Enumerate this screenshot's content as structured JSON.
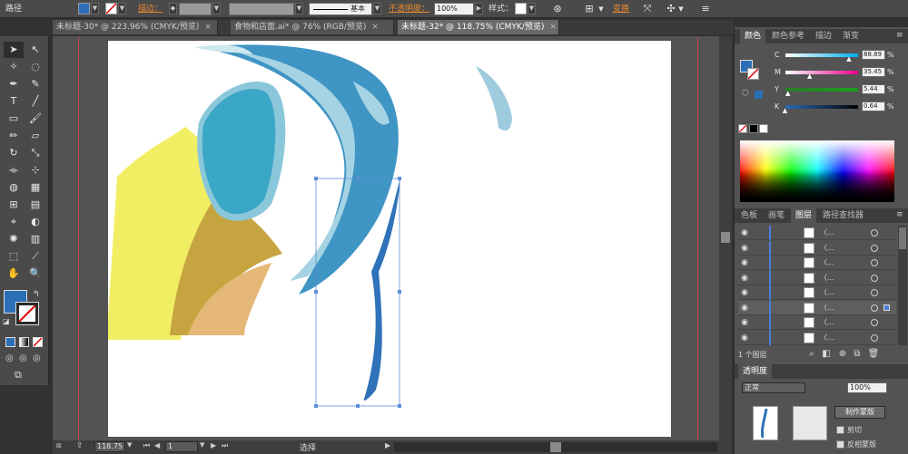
{
  "control_bar": {
    "object_type": "路径",
    "stroke_label": "描边：",
    "stroke_style": "基本",
    "opacity_label": "不透明度：",
    "opacity_value": "100%",
    "style_label": "样式：",
    "transform_label": "变换"
  },
  "tabs": [
    {
      "label": "未标题-30* @ 223.96% (CMYK/预览)",
      "close": "×"
    },
    {
      "label": "食物和店面.ai* @ 76% (RGB/预览)",
      "close": "×"
    },
    {
      "label": "未标题-32* @ 118.75% (CMYK/预览)",
      "close": "×"
    }
  ],
  "tools": {
    "icons": [
      [
        "selection-tool-icon",
        "➤"
      ],
      [
        "direct-selection-tool-icon",
        "↖"
      ],
      [
        "magic-wand-icon",
        "✧"
      ],
      [
        "lasso-icon",
        "◌"
      ],
      [
        "pen-tool-icon",
        "✒"
      ],
      [
        "curvature-icon",
        "✎"
      ],
      [
        "type-tool-icon",
        "T"
      ],
      [
        "line-tool-icon",
        "╱"
      ],
      [
        "rectangle-tool-icon",
        "▭"
      ],
      [
        "paintbrush-icon",
        "🖌"
      ],
      [
        "pencil-icon",
        "✏"
      ],
      [
        "eraser-icon",
        "▱"
      ],
      [
        "rotate-icon",
        "↻"
      ],
      [
        "scale-icon",
        "⤡"
      ],
      [
        "width-tool-icon",
        "⟛"
      ],
      [
        "free-transform-icon",
        "⊹"
      ],
      [
        "shape-builder-icon",
        "◍"
      ],
      [
        "perspective-grid-icon",
        "▦"
      ],
      [
        "mesh-icon",
        "⊞"
      ],
      [
        "gradient-icon",
        "▤"
      ],
      [
        "eyedropper-icon",
        "⌖"
      ],
      [
        "blend-icon",
        "◐"
      ],
      [
        "symbol-sprayer-icon",
        "✺"
      ],
      [
        "column-graph-icon",
        "▥"
      ],
      [
        "artboard-icon",
        "⬚"
      ],
      [
        "slice-icon",
        "⟋"
      ],
      [
        "hand-tool-icon",
        "✋"
      ],
      [
        "zoom-tool-icon",
        "🔍"
      ]
    ]
  },
  "status_bar": {
    "zoom": "118.75",
    "artboard_number": "1",
    "tool_name": "选择"
  },
  "color_panel": {
    "tabs": [
      "颜色",
      "颜色参考",
      "描边",
      "渐变"
    ],
    "sliders": [
      {
        "label": "C",
        "value": "88.89",
        "fraction": 0.89,
        "color_from": "#ffffff",
        "color_to": "#00aeef"
      },
      {
        "label": "M",
        "value": "35.45",
        "fraction": 0.35,
        "color_from": "#ffffff",
        "color_to": "#ec008c"
      },
      {
        "label": "Y",
        "value": "5.44",
        "fraction": 0.05,
        "color_from": "#2a7a2a",
        "color_to": "#1aa01a"
      },
      {
        "label": "K",
        "value": "0.64",
        "fraction": 0.01,
        "color_from": "#2a6ab8",
        "color_to": "#000000"
      }
    ]
  },
  "layers_panel": {
    "tabs": [
      "色板",
      "画笔",
      "图层",
      "路径查找器"
    ],
    "rows": [
      {
        "name": "〈..."
      },
      {
        "name": "〈..."
      },
      {
        "name": "〈..."
      },
      {
        "name": "〈..."
      },
      {
        "name": "〈..."
      },
      {
        "name": "〈..."
      },
      {
        "name": "〈..."
      },
      {
        "name": "〈..."
      }
    ],
    "count": "1 个图层"
  },
  "transparency_panel": {
    "title": "透明度",
    "mode": "正常",
    "value": "100%",
    "make_mask_button": "制作蒙版",
    "clip_label": "剪切",
    "invert_label": "反相蒙版"
  },
  "colors": {
    "fill": "#2c6fb7",
    "accent": "#e68a2e"
  }
}
